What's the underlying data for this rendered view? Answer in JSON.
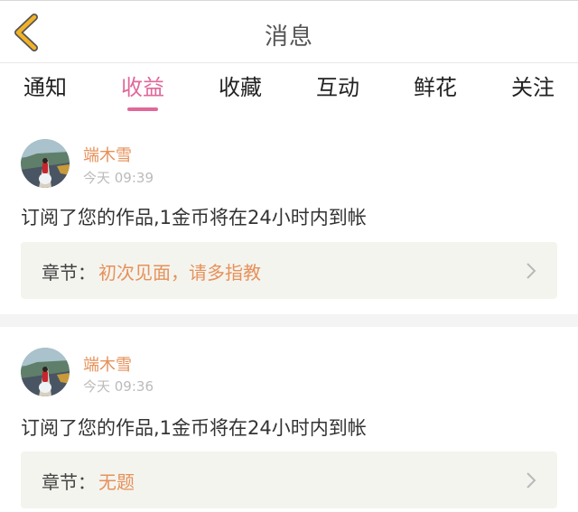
{
  "header": {
    "back_icon": "chevron-left-icon",
    "title": "消息",
    "accent": "#f2b227"
  },
  "tabs": [
    {
      "label": "通知",
      "active": false
    },
    {
      "label": "收益",
      "active": true
    },
    {
      "label": "收藏",
      "active": false
    },
    {
      "label": "互动",
      "active": false
    },
    {
      "label": "鲜花",
      "active": false
    },
    {
      "label": "关注",
      "active": false
    }
  ],
  "colors": {
    "active_tab": "#e0689a",
    "username": "#e6915a",
    "chapter_title": "#e6915a",
    "time": "#bbbbbb"
  },
  "messages": [
    {
      "username": "端木雪",
      "time": "今天 09:39",
      "text": "订阅了您的作品,1金币将在24小时内到帐",
      "chapter_label": "章节：",
      "chapter_title": "初次见面，请多指教"
    },
    {
      "username": "端木雪",
      "time": "今天 09:36",
      "text": "订阅了您的作品,1金币将在24小时内到帐",
      "chapter_label": "章节：",
      "chapter_title": "无题"
    }
  ]
}
